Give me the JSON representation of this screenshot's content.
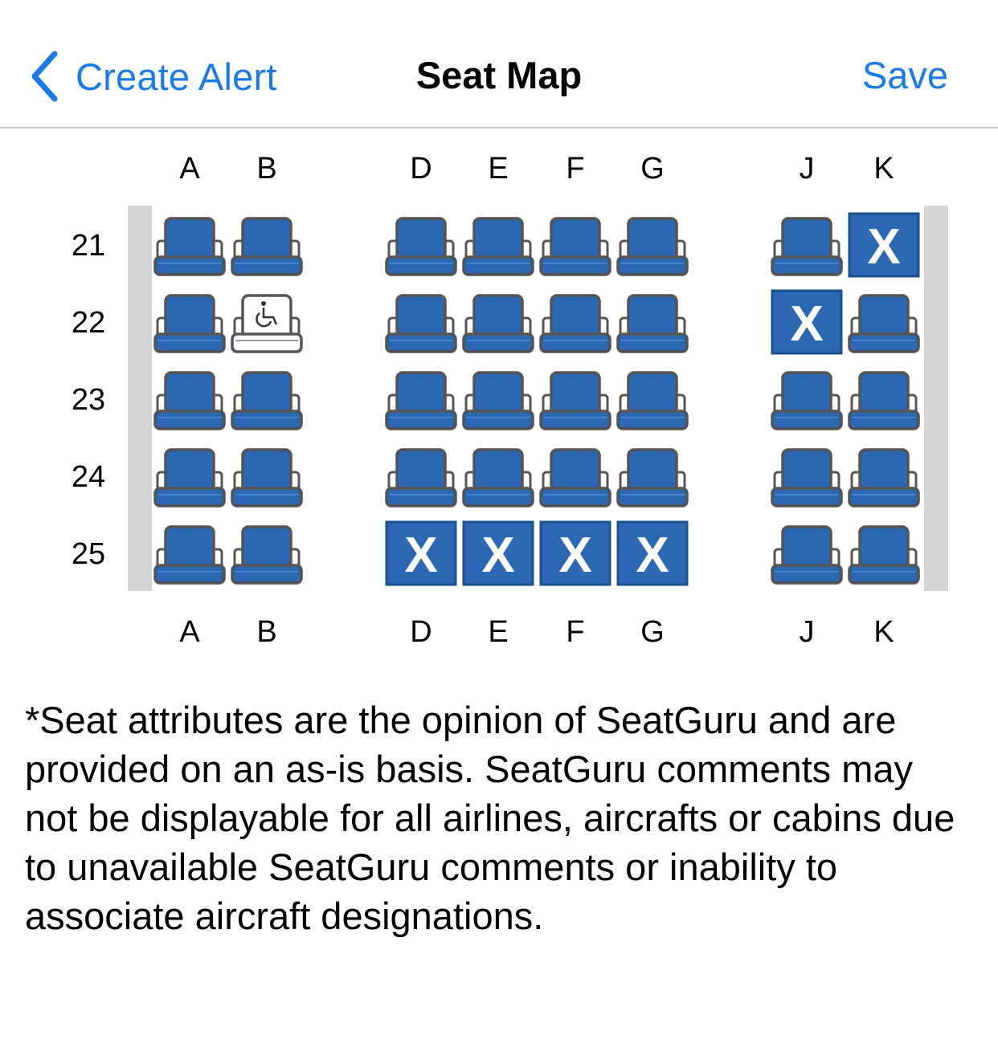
{
  "nav": {
    "back_label": "Create Alert",
    "title": "Seat Map",
    "save_label": "Save"
  },
  "columns": [
    "A",
    "B",
    "D",
    "E",
    "F",
    "G",
    "J",
    "K"
  ],
  "rows": [
    "21",
    "22",
    "23",
    "24",
    "25"
  ],
  "seats": {
    "21": [
      "available",
      "available",
      "available",
      "available",
      "available",
      "available",
      "available",
      "occupied"
    ],
    "22": [
      "available",
      "accessible",
      "available",
      "available",
      "available",
      "available",
      "occupied",
      "available"
    ],
    "23": [
      "available",
      "available",
      "available",
      "available",
      "available",
      "available",
      "available",
      "available"
    ],
    "24": [
      "available",
      "available",
      "available",
      "available",
      "available",
      "available",
      "available",
      "available"
    ],
    "25": [
      "available",
      "available",
      "occupied",
      "occupied",
      "occupied",
      "occupied",
      "available",
      "available"
    ]
  },
  "occupied_mark": "X",
  "icons": {
    "back": "chevron-left-icon",
    "accessible": "wheelchair-icon"
  },
  "colors": {
    "accent": "#1a7ae6",
    "seat_blue": "#2c67b4",
    "seat_outline": "#555555",
    "wall": "#d5d5d5"
  },
  "disclaimer": "*Seat attributes are the opinion of SeatGuru and are provided on an as-is basis. SeatGuru comments may not be displayable for all airlines, aircrafts or cabins due to unavailable SeatGuru comments or inability to associate aircraft designations."
}
